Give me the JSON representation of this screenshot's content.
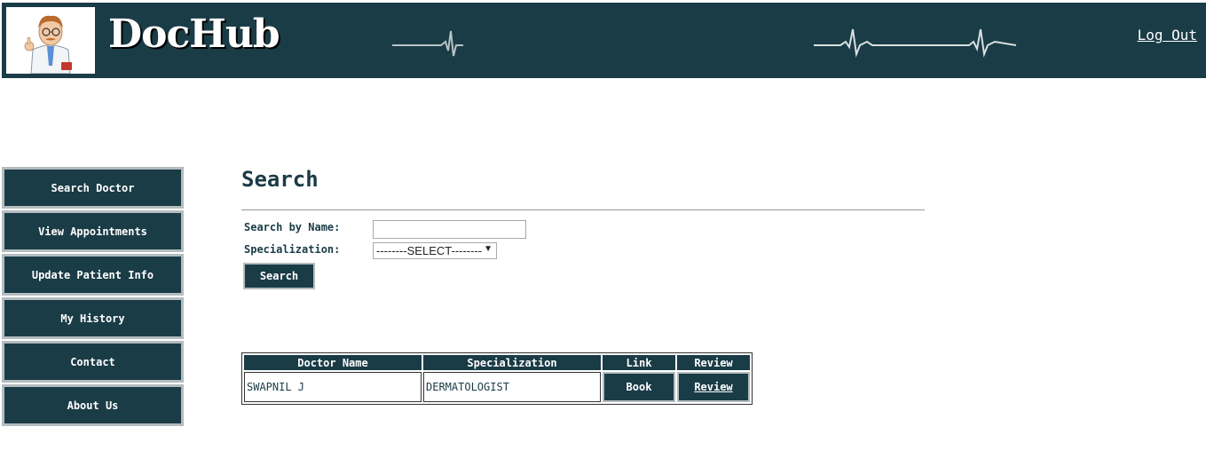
{
  "header": {
    "brand": "DocHub",
    "logout_label": "Log Out",
    "bg_color": "#1a3c46"
  },
  "sidebar": {
    "items": [
      {
        "label": "Search Doctor"
      },
      {
        "label": "View Appointments"
      },
      {
        "label": "Update Patient Info"
      },
      {
        "label": "My History"
      },
      {
        "label": "Contact"
      },
      {
        "label": "About Us"
      }
    ]
  },
  "main": {
    "title": "Search",
    "search_by_name_label": "Search by Name:",
    "name_value": "",
    "specialization_label": "Specialization:",
    "specialization_selected": "--------SELECT--------",
    "search_button": "Search"
  },
  "results": {
    "headers": [
      "Doctor Name",
      "Specialization",
      "Link",
      "Review"
    ],
    "rows": [
      {
        "doctor_name": "SWAPNIL J",
        "specialization": "DERMATOLOGIST",
        "link": "Book",
        "review": "Review"
      }
    ]
  }
}
